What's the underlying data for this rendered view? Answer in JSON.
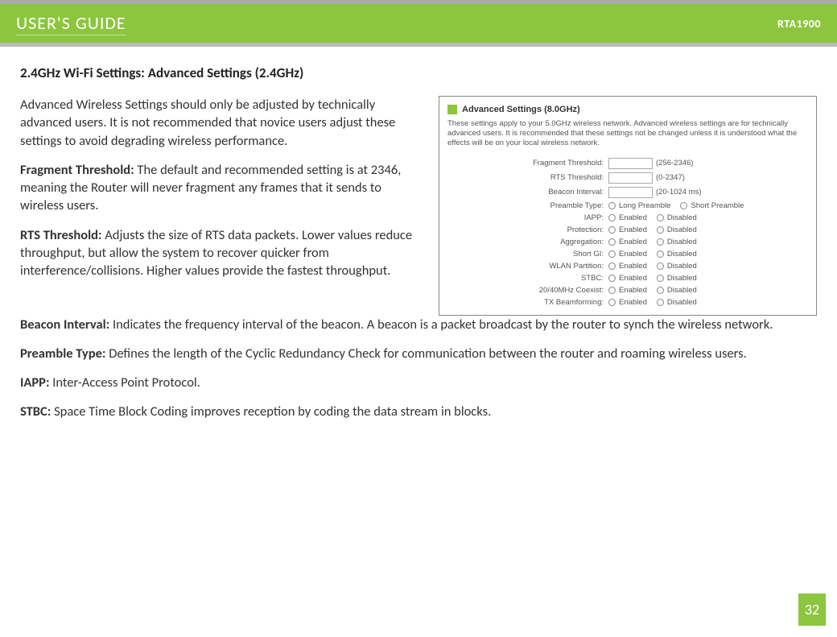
{
  "header": {
    "guide_title": "USER'S GUIDE",
    "model": "RTA1900"
  },
  "section_title": "2.4GHz Wi-Fi Settings: Advanced Settings (2.4GHz)",
  "intro": "Advanced Wireless Settings should only be adjusted by technically advanced users. It is not recommended that novice users adjust these settings to avoid degrading wireless performance.",
  "definitions": {
    "fragment_threshold": {
      "label": "Fragment Threshold:",
      "text": " The default and recommended setting is at 2346, meaning the Router will never fragment any frames that it sends to wireless users."
    },
    "rts_threshold": {
      "label": "RTS Threshold:",
      "text": " Adjusts the size of RTS data packets. Lower values reduce throughput, but allow the system to recover quicker from interference/collisions. Higher values provide the fastest throughput."
    },
    "beacon_interval": {
      "label": "Beacon Interval:",
      "text": " Indicates the frequency interval of the beacon. A beacon is a packet broadcast by the router to synch the wireless network."
    },
    "preamble_type": {
      "label": "Preamble Type:",
      "text": " Defines the length of the Cyclic Redundancy Check for communication between the router and roaming wireless users."
    },
    "iapp": {
      "label": "IAPP:",
      "text": " Inter-Access Point Protocol."
    },
    "stbc": {
      "label": "STBC:",
      "text": " Space Time Block Coding improves reception by coding the data stream in blocks."
    }
  },
  "panel": {
    "title": "Advanced Settings (8.0GHz)",
    "description": "These settings apply to your 5.0GHz wireless network. Advanced wireless settings are for technically advanced users. It is recommended that these settings not be changed unless it is understood what the effects will be on your local wireless network.",
    "rows": [
      {
        "label": "Fragment Threshold:",
        "type": "input",
        "hint": "(256-2346)"
      },
      {
        "label": "RTS Threshold:",
        "type": "input",
        "hint": "(0-2347)"
      },
      {
        "label": "Beacon Interval:",
        "type": "input",
        "hint": "(20-1024 ms)"
      },
      {
        "label": "Preamble Type:",
        "type": "radio2",
        "opt1": "Long Preamble",
        "opt2": "Short Preamble"
      },
      {
        "label": "IAPP:",
        "type": "radio2",
        "opt1": "Enabled",
        "opt2": "Disabled"
      },
      {
        "label": "Protection:",
        "type": "radio2",
        "opt1": "Enabled",
        "opt2": "Disabled"
      },
      {
        "label": "Aggregation:",
        "type": "radio2",
        "opt1": "Enabled",
        "opt2": "Disabled"
      },
      {
        "label": "Short GI:",
        "type": "radio2",
        "opt1": "Enabled",
        "opt2": "Disabled"
      },
      {
        "label": "WLAN Partition:",
        "type": "radio2",
        "opt1": "Enabled",
        "opt2": "Disabled"
      },
      {
        "label": "STBC:",
        "type": "radio2",
        "opt1": "Enabled",
        "opt2": "Disabled"
      },
      {
        "label": "20/40MHz Coexist:",
        "type": "radio2",
        "opt1": "Enabled",
        "opt2": "Disabled"
      },
      {
        "label": "TX Beamforming:",
        "type": "radio2",
        "opt1": "Enabled",
        "opt2": "Disabled"
      }
    ]
  },
  "page_number": "32"
}
